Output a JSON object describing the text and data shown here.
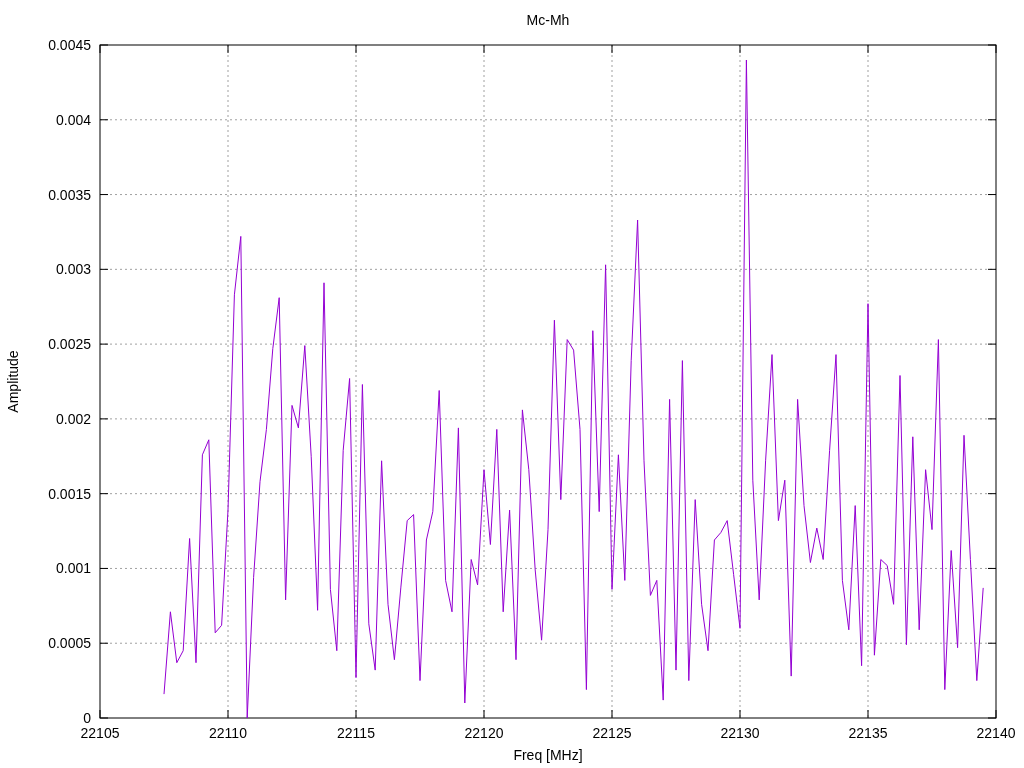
{
  "chart_data": {
    "type": "line",
    "title": "Mc-Mh",
    "xlabel": "Freq [MHz]",
    "ylabel": "Amplitude",
    "grid": true,
    "xlim": [
      22105,
      22140
    ],
    "ylim": [
      0,
      0.0045
    ],
    "xticks": [
      22105,
      22110,
      22115,
      22120,
      22125,
      22130,
      22135,
      22140
    ],
    "yticks": [
      0,
      0.0005,
      0.001,
      0.0015,
      0.002,
      0.0025,
      0.003,
      0.0035,
      0.004,
      0.0045
    ],
    "x": [
      22107.5,
      22107.75,
      22108,
      22108.25,
      22108.5,
      22108.75,
      22109,
      22109.25,
      22109.5,
      22109.75,
      22110,
      22110.25,
      22110.5,
      22110.75,
      22111,
      22111.25,
      22111.5,
      22111.75,
      22112,
      22112.25,
      22112.5,
      22112.75,
      22113,
      22113.25,
      22113.5,
      22113.75,
      22114,
      22114.25,
      22114.5,
      22114.75,
      22115,
      22115.25,
      22115.5,
      22115.75,
      22116,
      22116.25,
      22116.5,
      22116.75,
      22117,
      22117.25,
      22117.5,
      22117.75,
      22118,
      22118.25,
      22118.5,
      22118.75,
      22119,
      22119.25,
      22119.5,
      22119.75,
      22120,
      22120.25,
      22120.5,
      22120.75,
      22121,
      22121.25,
      22121.5,
      22121.75,
      22122,
      22122.25,
      22122.5,
      22122.75,
      22123,
      22123.25,
      22123.5,
      22123.75,
      22124,
      22124.25,
      22124.5,
      22124.75,
      22125,
      22125.25,
      22125.5,
      22125.75,
      22126,
      22126.25,
      22126.5,
      22126.75,
      22127,
      22127.25,
      22127.5,
      22127.75,
      22128,
      22128.25,
      22128.5,
      22128.75,
      22129,
      22129.25,
      22129.5,
      22129.75,
      22130,
      22130.25,
      22130.5,
      22130.75,
      22131,
      22131.25,
      22131.5,
      22131.75,
      22132,
      22132.25,
      22132.5,
      22132.75,
      22133,
      22133.25,
      22133.5,
      22133.75,
      22134,
      22134.25,
      22134.5,
      22134.75,
      22135,
      22135.25,
      22135.5,
      22135.75,
      22136,
      22136.25,
      22136.5,
      22136.75,
      22137,
      22137.25,
      22137.5,
      22137.75,
      22138,
      22138.25,
      22138.5,
      22138.75,
      22139,
      22139.25,
      22139.5
    ],
    "series": [
      {
        "color": "#9400d3",
        "values": [
          0.00016,
          0.00071,
          0.00037,
          0.00045,
          0.0012,
          0.00037,
          0.00176,
          0.00186,
          0.00057,
          0.00062,
          0.00139,
          0.00283,
          0.00322,
          0,
          0.00094,
          0.00158,
          0.00193,
          0.00247,
          0.00281,
          0.00079,
          0.00209,
          0.00194,
          0.00249,
          0.00175,
          0.00072,
          0.00291,
          0.00086,
          0.00045,
          0.00179,
          0.00227,
          0.00027,
          0.00223,
          0.00063,
          0.00032,
          0.00172,
          0.00076,
          0.00039,
          0.00087,
          0.00132,
          0.00136,
          0.00025,
          0.00119,
          0.00138,
          0.00219,
          0.00092,
          0.00071,
          0.00194,
          0.0001,
          0.00106,
          0.00089,
          0.00166,
          0.00116,
          0.00193,
          0.00071,
          0.00139,
          0.00039,
          0.00206,
          0.00166,
          0.00099,
          0.00052,
          0.00126,
          0.00266,
          0.00146,
          0.00253,
          0.00246,
          0.00193,
          0.00019,
          0.00259,
          0.00138,
          0.00303,
          0.00086,
          0.00176,
          0.00092,
          0.00239,
          0.00333,
          0.00172,
          0.00082,
          0.00092,
          0.00012,
          0.00213,
          0.00032,
          0.00239,
          0.00025,
          0.00146,
          0.00076,
          0.00045,
          0.00119,
          0.00124,
          0.00132,
          0.00096,
          0.0006,
          0.0044,
          0.00159,
          0.00079,
          0.00172,
          0.00243,
          0.00132,
          0.00159,
          0.00028,
          0.00213,
          0.00142,
          0.00104,
          0.00127,
          0.00106,
          0.00179,
          0.00243,
          0.00092,
          0.00059,
          0.00142,
          0.00035,
          0.00277,
          0.00042,
          0.00106,
          0.00102,
          0.00076,
          0.00229,
          0.00049,
          0.00188,
          0.00059,
          0.00166,
          0.00126,
          0.00253,
          0.00019,
          0.00112,
          0.00047,
          0.00189,
          0.00106,
          0.00025,
          0.00087
        ]
      }
    ]
  }
}
